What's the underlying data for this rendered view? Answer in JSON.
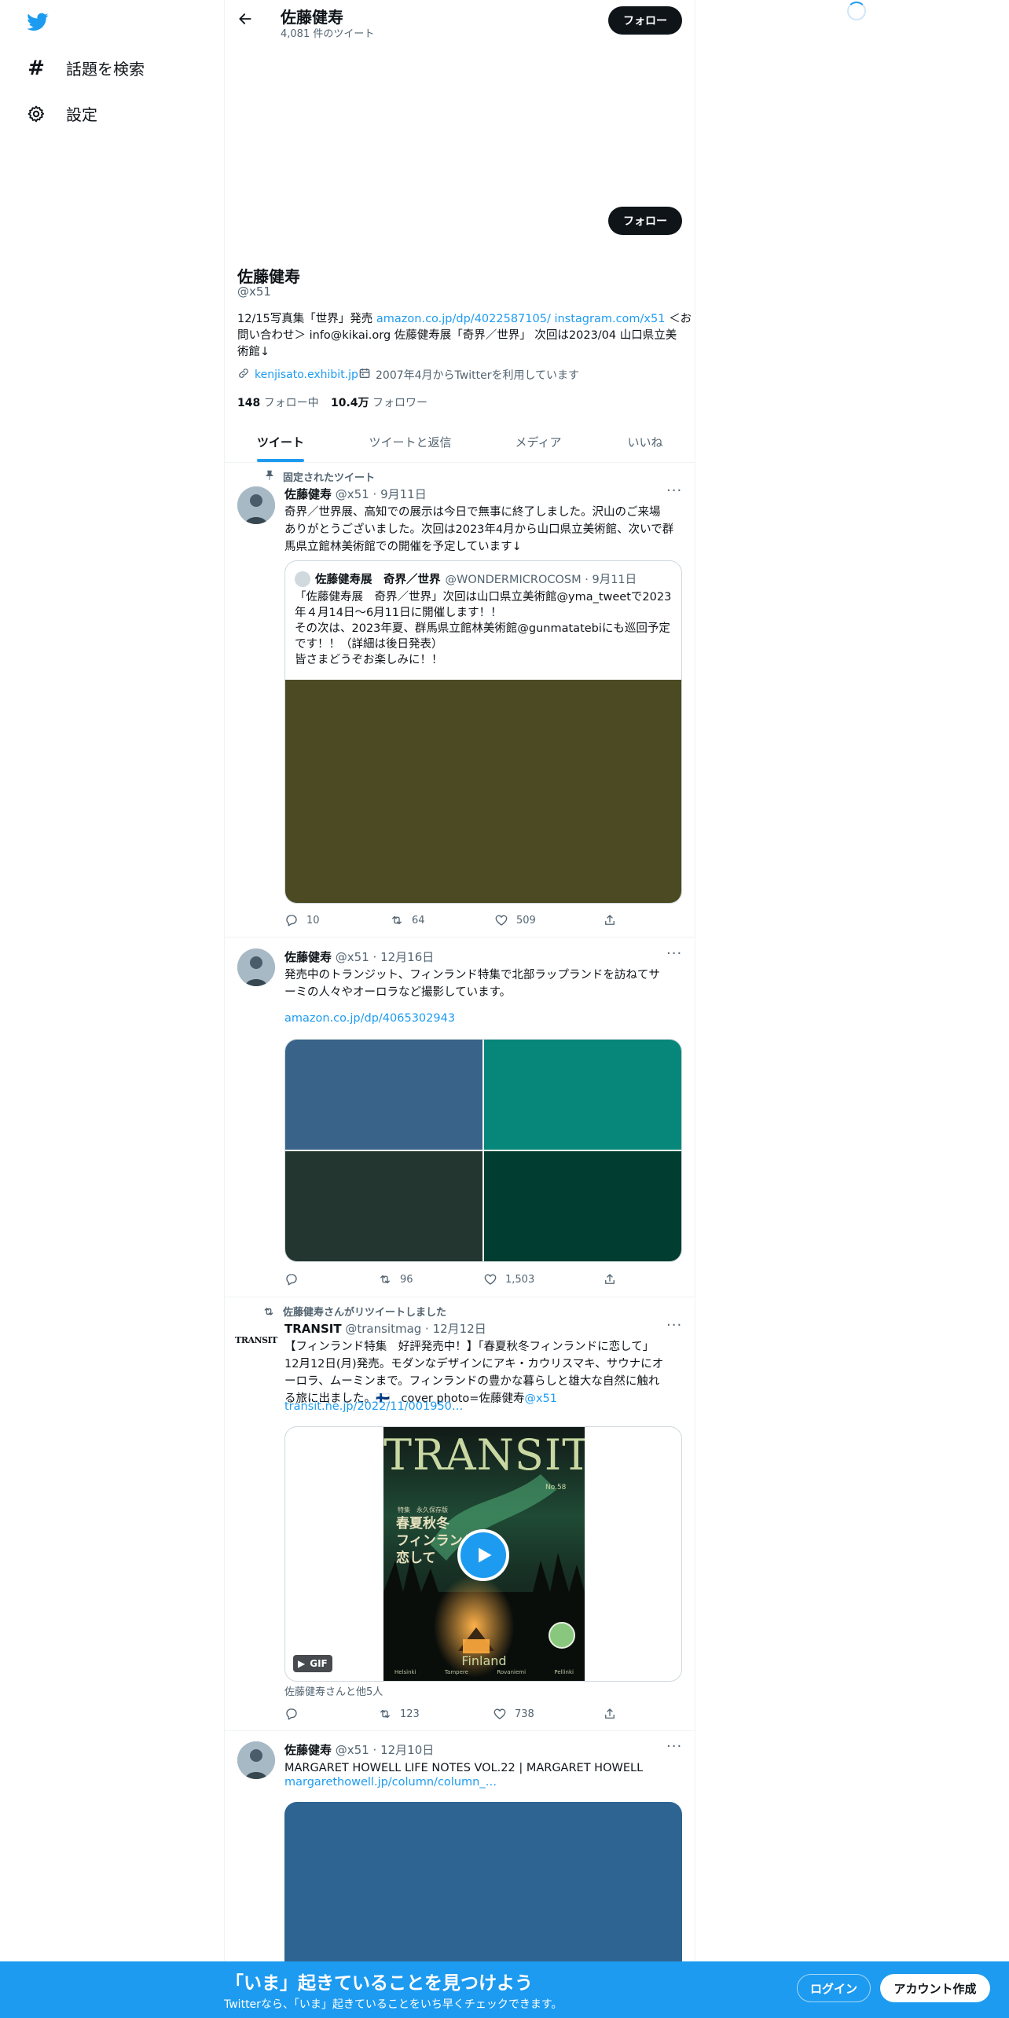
{
  "nav": {
    "explore_label": "話題を検索",
    "settings_label": "設定"
  },
  "header": {
    "name": "佐藤健寿",
    "tweet_count": "4,081 件のツイート",
    "follow_label": "フォロー"
  },
  "profile": {
    "follow_label": "フォロー",
    "name": "佐藤健寿",
    "handle": "@x51",
    "bio_line1_pre": "12/15写真集「世界」発売 ",
    "bio_link_amazon": "amazon.co.jp/dp/4022587105/",
    "bio_link_instagram": "instagram.com/x51",
    "bio_line1_post": " ＜お",
    "bio_line2": "問い合わせ＞ info@kikai.org 佐藤健寿展「奇界／世界」 次回は2023/04 山口県立美",
    "bio_line3": "術館↓",
    "website": "kenjisato.exhibit.jp",
    "joined": "2007年4月からTwitterを利用しています",
    "following_count": "148",
    "following_label": "フォロー中",
    "followers_count": "10.4万",
    "followers_label": "フォロワー"
  },
  "tabs": [
    "ツイート",
    "ツイートと返信",
    "メディア",
    "いいね"
  ],
  "tweets": [
    {
      "context": "固定されたツイート",
      "name": "佐藤健寿",
      "meta": "@x51 · 9月11日",
      "lines": [
        "奇界／世界展、高知での展示は今日で無事に終了しました。沢山のご来場",
        "ありがとうございました。次回は2023年4月から山口県立美術館、次いで群",
        "馬県立館林美術館での開催を予定しています↓"
      ],
      "quote": {
        "name": "佐藤健寿展　奇界／世界",
        "meta": "@WONDERMICROCOSM · 9月11日",
        "lines": [
          "「佐藤健寿展　奇界／世界」次回は山口県立美術館@yma_tweetで2023",
          "年４月14日～6月11日に開催します！！",
          "その次は、2023年夏、群馬県立館林美術館@gunmatatebiにも巡回予定",
          "です！！（詳細は後日発表）",
          "皆さまどうぞお楽しみに！！"
        ]
      },
      "replies": "10",
      "retweets": "64",
      "likes": "509"
    },
    {
      "name": "佐藤健寿",
      "meta": "@x51 · 12月16日",
      "lines": [
        "発売中のトランジット、フィンランド特集で北部ラップランドを訪ねてサ",
        "ーミの人々やオーロラなど撮影しています。"
      ],
      "link": "amazon.co.jp/dp/4065302943",
      "replies": "",
      "retweets": "96",
      "likes": "1,503"
    },
    {
      "context": "佐藤健寿さんがリツイートしました",
      "avatar_text": "TRANSIT",
      "name": "TRANSIT",
      "meta": "@transitmag · 12月12日",
      "lines": [
        "【フィンランド特集　好評発売中！】「春夏秋冬フィンランドに恋して」",
        "12月12日(月)発売。モダンなデザインにアキ・カウリスマキ、サウナにオ",
        "ーロラ、ムーミンまで。フィンランドの豊かな暮らしと雄大な自然に触れ",
        "る旅に出ました。🇫🇮　cover photo=佐藤健寿"
      ],
      "mention": "@x51",
      "link": "transit.ne.jp/2022/11/001950…",
      "cover": {
        "title": "TRANSIT",
        "issue": "No.58",
        "kicker": "特集　永久保存版",
        "headline1": "春夏秋冬",
        "headline2": "フィンランドに",
        "headline3": "恋して",
        "country": "Finland",
        "cities": [
          "Helsinki",
          "Tampere",
          "Rovaniemi",
          "Pellinki"
        ]
      },
      "gif_label": "GIF",
      "liked_by": "佐藤健寿さんと他5人",
      "replies": "",
      "retweets": "123",
      "likes": "738"
    },
    {
      "name": "佐藤健寿",
      "meta": "@x51 · 12月10日",
      "lines": [
        "MARGARET HOWELL LIFE NOTES VOL.22 | MARGARET HOWELL"
      ],
      "link": "margarethowell.jp/column/column_…"
    }
  ],
  "banner": {
    "title": "「いま」起きていることを見つけよう",
    "subtitle": "Twitterなら、「いま」起きていることをいち早くチェックできます。",
    "login_label": "ログイン",
    "signup_label": "アカウント作成"
  },
  "colors": {
    "accent": "#1d9bf0",
    "quote_image": "#4c4a22",
    "grid": [
      "#3a6389",
      "#07877a",
      "#23362f",
      "#023d31"
    ],
    "margaret_image": "#2e6492"
  }
}
